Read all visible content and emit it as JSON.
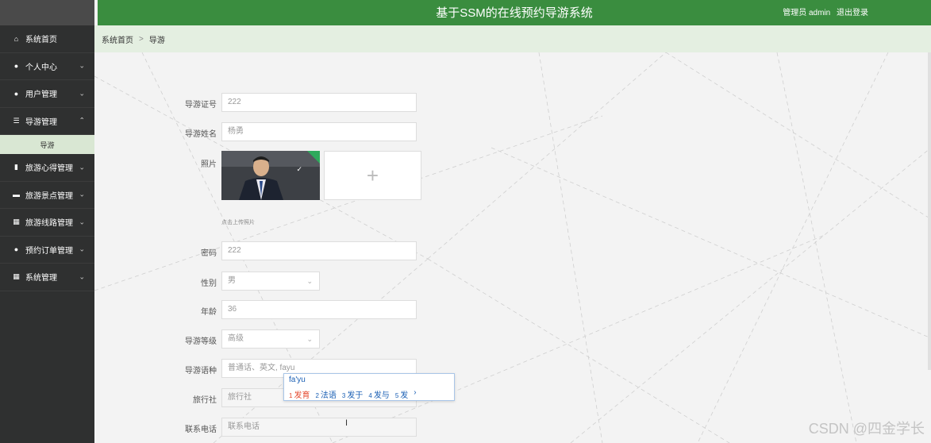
{
  "header": {
    "title": "基于SSM的在线预约导游系统",
    "user_label": "管理员 admin",
    "logout_label": "退出登录",
    "color": "#3a8d3f"
  },
  "sidebar": {
    "items": [
      {
        "label": "系统首页",
        "icon": "home-icon"
      },
      {
        "label": "个人中心",
        "icon": "user-icon"
      },
      {
        "label": "用户管理",
        "icon": "user-icon"
      },
      {
        "label": "导游管理",
        "icon": "sliders-icon",
        "sub": "导游"
      },
      {
        "label": "旅游心得管理",
        "icon": "notebook-icon"
      },
      {
        "label": "旅游景点管理",
        "icon": "ticket-icon"
      },
      {
        "label": "旅游线路管理",
        "icon": "grid-icon"
      },
      {
        "label": "预约订单管理",
        "icon": "bulb-icon"
      },
      {
        "label": "系统管理",
        "icon": "grid-icon"
      }
    ]
  },
  "breadcrumb": {
    "home": "系统首页",
    "sep": ">",
    "current": "导游"
  },
  "form": {
    "guide_no": {
      "label": "导游证号",
      "value": "222"
    },
    "guide_name": {
      "label": "导游姓名",
      "value": "杨勇"
    },
    "photo": {
      "label": "照片",
      "hint": "点击上传照片"
    },
    "password": {
      "label": "密码",
      "value": "222"
    },
    "gender": {
      "label": "性别",
      "value": "男"
    },
    "age": {
      "label": "年龄",
      "value": "36"
    },
    "level": {
      "label": "导游等级",
      "value": "高级"
    },
    "language": {
      "label": "导游语种",
      "value": "普通话、英文, fayu"
    },
    "agency": {
      "label": "旅行社",
      "placeholder": "旅行社"
    },
    "phone": {
      "label": "联系电话",
      "placeholder": "联系电话"
    }
  },
  "ime": {
    "composition": "fa'yu",
    "candidates": [
      {
        "n": "1",
        "text": "发育"
      },
      {
        "n": "2",
        "text": "法语"
      },
      {
        "n": "3",
        "text": "发于"
      },
      {
        "n": "4",
        "text": "发与"
      },
      {
        "n": "5",
        "text": "发"
      }
    ]
  },
  "watermark": "CSDN @四金学长"
}
